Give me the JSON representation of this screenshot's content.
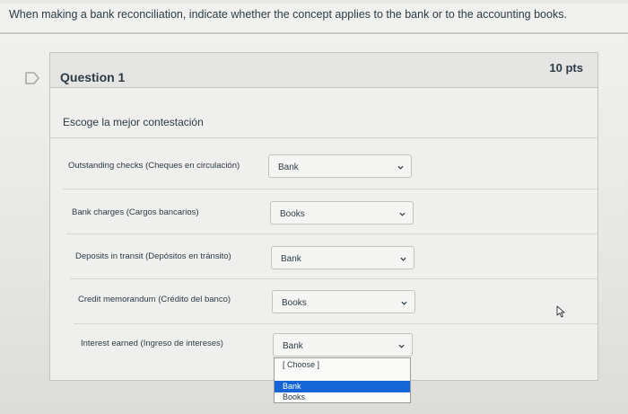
{
  "instruction": "When making a bank reconciliation, indicate whether the concept applies to the bank or to the accounting books.",
  "question": {
    "title": "Question 1",
    "points": "10 pts",
    "prompt": "Escoge la mejor contestación"
  },
  "rows": [
    {
      "term": "Outstanding checks (Cheques en circulación)",
      "selected": "Bank"
    },
    {
      "term": "Bank charges (Cargos bancarios)",
      "selected": "Books"
    },
    {
      "term": "Deposits in transit (Depósitos en tránsito)",
      "selected": "Bank"
    },
    {
      "term": "Credit memorandum (Crédito del banco)",
      "selected": "Books"
    },
    {
      "term": "Interest earned (Ingreso de intereses)",
      "selected": "Bank"
    }
  ],
  "dropdown": {
    "options": [
      "[ Choose ]",
      "Bank",
      "Books"
    ],
    "highlighted": "Bank"
  },
  "icons": {
    "flag": "flag-icon",
    "chevron": "chevron-down-icon",
    "cursor": "mouse-cursor-icon"
  },
  "colors": {
    "highlight": "#1565d6",
    "text": "#2d3b45"
  }
}
